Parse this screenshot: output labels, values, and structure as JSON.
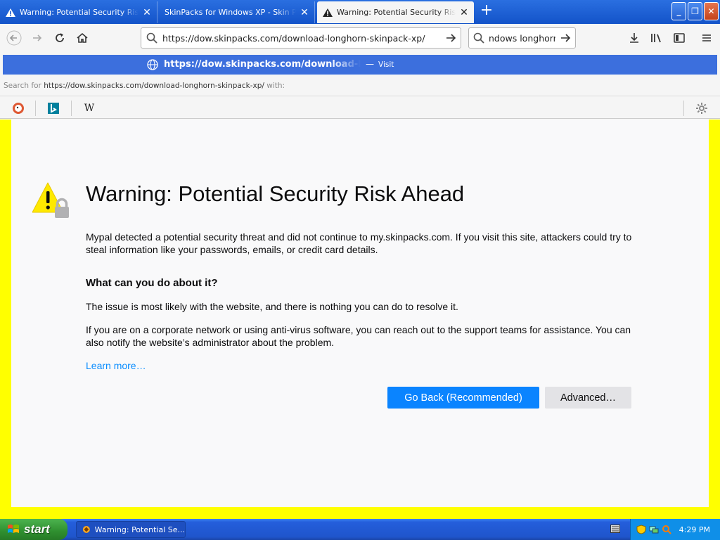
{
  "browser": {
    "tabs": [
      {
        "title": "Warning: Potential Security Risk Ahead",
        "icon": "warning-icon",
        "selected": false
      },
      {
        "title": "SkinPacks for Windows XP - Skin Pack for Windows",
        "icon": "none",
        "selected": false
      },
      {
        "title": "Warning: Potential Security Risk Ahead",
        "icon": "warning-icon",
        "selected": true
      }
    ],
    "url": "https://dow.skinpacks.com/download-longhorn-skinpack-xp/",
    "search_query": "ndows longhorn"
  },
  "autocomplete": {
    "url": "https://dow.skinpacks.com/download-longhorn-skinpack-xp/",
    "dash": "—",
    "action": "Visit",
    "search_for_label": "Search for",
    "search_for_query": "https://dow.skinpacks.com/download-longhorn-skinpack-xp/",
    "search_for_suffix": "with:",
    "engines": [
      "duckduckgo-icon",
      "bing-icon",
      "wikipedia-icon"
    ],
    "wikipedia_glyph": "W"
  },
  "page": {
    "title": "Warning: Potential Security Risk Ahead",
    "intro": "Mypal detected a potential security threat and did not continue to my.skinpacks.com. If you visit this site, attackers could try to steal information like your passwords, emails, or credit card details.",
    "subhead": "What can you do about it?",
    "para1": "The issue is most likely with the website, and there is nothing you can do to resolve it.",
    "para2": "If you are on a corporate network or using anti-virus software, you can reach out to the support teams for assistance. You can also notify the website’s administrator about the problem.",
    "learn_more": "Learn more…",
    "go_back": "Go Back (Recommended)",
    "advanced": "Advanced…"
  },
  "taskbar": {
    "start": "start",
    "task_label": "Warning: Potential Se...",
    "clock": "4:29 PM"
  },
  "colors": {
    "titlebar": "#1353c9",
    "accent": "#0a84ff",
    "warning_yellow": "#ffe900",
    "desktop_background": "#ffff00"
  }
}
